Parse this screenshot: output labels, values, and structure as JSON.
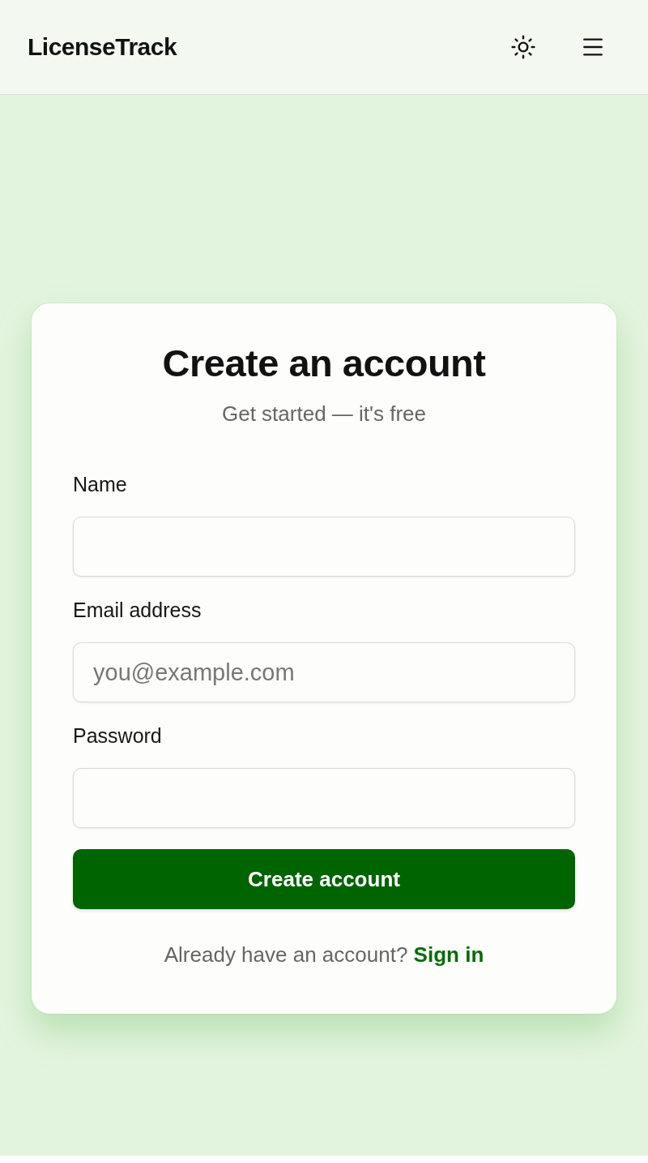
{
  "header": {
    "brand": "LicenseTrack"
  },
  "form": {
    "title": "Create an account",
    "subtitle": "Get started — it's free",
    "fields": [
      {
        "label": "Name"
      },
      {
        "label": "Email address",
        "placeholder": "you@example.com"
      },
      {
        "label": "Password"
      }
    ],
    "submit": "Create account",
    "footer": {
      "prompt": "Already have an account?",
      "link": "Sign in"
    }
  }
}
